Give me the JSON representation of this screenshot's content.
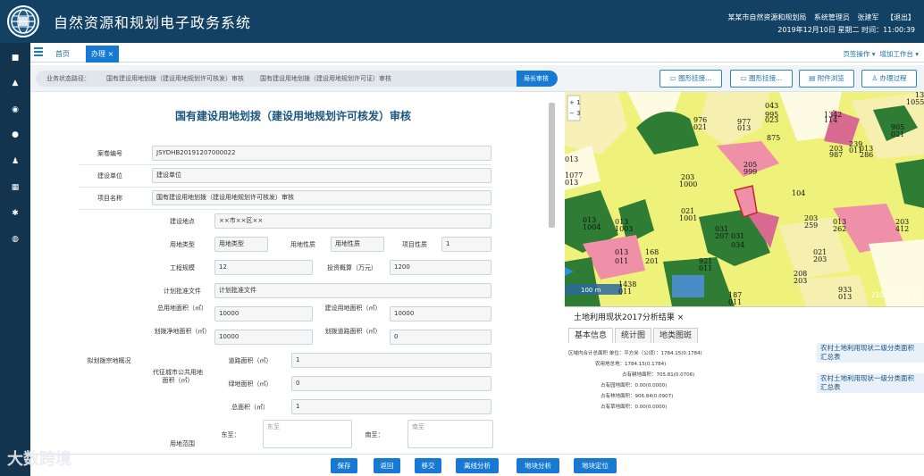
{
  "app": {
    "title": "自然资源和规划电子政务系统"
  },
  "header": {
    "org": "某某市自然资源和规划局",
    "admin": "系统管理员",
    "user": "张建军",
    "logout": "【退出】",
    "datetime": "2019年12月10日 星期二 时间：11:00:39"
  },
  "tabs": {
    "home": "首页",
    "active": "办理 ×"
  },
  "tabbar_right": {
    "page_ops": "页签操作 ▾",
    "add_workspace": "增加工作台 ▾"
  },
  "breadcrumb": {
    "label": "业务状态路径：",
    "steps": [
      "国有建设用地划拨（建设用地规划许可核发）审核",
      "国有建设用地划拨（建设用地规划许可证）审核"
    ],
    "current": "局长审核"
  },
  "toolbar": {
    "attach1": "图形挂接...",
    "attach2": "图形挂接...",
    "attachment_view": "附件浏览",
    "process": "办理过程"
  },
  "form": {
    "title": "国有建设用地划拨（建设用地规划许可核发）审核",
    "case_no_label": "案卷编号",
    "case_no": "JSYDHB20191207000022",
    "unit_label": "建设单位",
    "unit": "建设单位",
    "project_label": "项目名称",
    "project": "国有建设用地划拨（建设用地规划许可核发）审核",
    "group_label": "拟划拨宗地概况",
    "location_label": "建设地点",
    "location": "××市××区××",
    "land_type_label": "用地类型",
    "land_type": "用地类型",
    "land_nature_label": "用地性质",
    "land_nature": "用地性质",
    "project_nature_label": "项目性质",
    "project_nature": "1",
    "scale_label": "工程规模",
    "scale": "12",
    "invest_label": "投资概算（万元）",
    "invest": "1200",
    "plan_doc_label": "计划批准文件",
    "plan_doc": "计划批准文件",
    "total_area_label": "总用地面积（㎡）",
    "total_area": "10000",
    "build_area_label": "建设用地面积（㎡）",
    "build_area": "10000",
    "net_area_label": "划拨净地面积（㎡）",
    "net_area": "10000",
    "road_area_label": "划拨道路面积（㎡）",
    "road_area": "0",
    "public_label": "代征城市公共用地面积（㎡）",
    "road_label": "道路面积（㎡）",
    "road": "1",
    "green_label": "绿地面积（㎡）",
    "green": "0",
    "sum_label": "总面积（㎡）",
    "sum": "1",
    "range_label": "用地范围",
    "east_label": "东至：",
    "east": "东至",
    "south_label": "南至：",
    "south": "南至"
  },
  "map": {
    "zoom_in": "+ 1",
    "zoom_out": "− 3",
    "scale": "100 m",
    "coords": "2104.59.28.7.2",
    "labels": [
      "976",
      "021",
      "977",
      "013",
      "995",
      "023",
      "1342",
      "114",
      "239",
      "011",
      "875",
      "203",
      "987",
      "013",
      "286",
      "013",
      "205",
      "999",
      "203",
      "1000",
      "021",
      "1001",
      "013",
      "1004",
      "013",
      "1003",
      "031",
      "207",
      "031",
      "034",
      "203",
      "259",
      "013",
      "262",
      "203",
      "412",
      "013",
      "168",
      "201",
      "011",
      "021",
      "203",
      "1341",
      "104",
      "921",
      "011",
      "208",
      "203",
      "933",
      "013",
      "1438",
      "011",
      "187",
      "011",
      "1077",
      "013",
      "905",
      "021",
      "1055",
      "043",
      "011",
      "203"
    ]
  },
  "results": {
    "title": "土地利用现状2017分析结果 ×",
    "tabs": [
      "基本信息",
      "统计图",
      "地类图斑"
    ],
    "lines": [
      "区域内合计总面积 单位：平方米（公顷）：1784.15(0.1784)",
      "农用地总地：1784.15(0.1784)",
      "占有耕地面积：705.81(0.0706)",
      "占有园地面积：0.00(0.0000)",
      "占有林地面积：906.84(0.0907)",
      "占有草地面积：0.00(0.0000)"
    ],
    "list": [
      "农村土地利用现状二级分类面积汇总表",
      "农村土地利用现状一级分类面积汇总表"
    ]
  },
  "buttons": {
    "save": "保存",
    "back": "返回",
    "transfer": "移交",
    "redline": "离线分析",
    "parcel_analysis": "地块分析",
    "parcel_locate": "地块定位"
  },
  "watermark": "大数跨境"
}
